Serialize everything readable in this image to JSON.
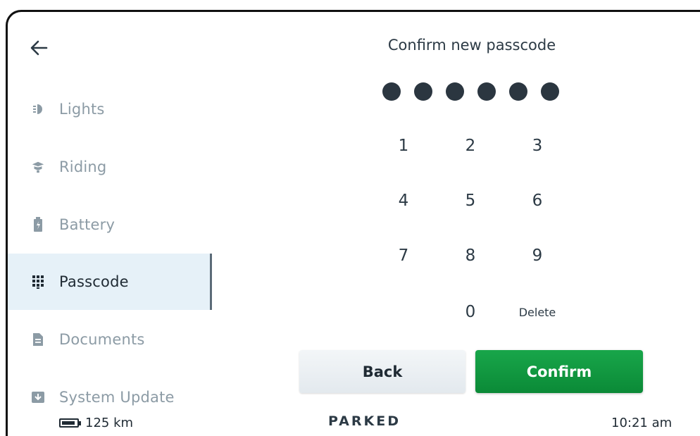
{
  "sidebar": {
    "items": [
      {
        "label": "Lights",
        "icon": "headlight-icon"
      },
      {
        "label": "Riding",
        "icon": "rider-icon"
      },
      {
        "label": "Battery",
        "icon": "battery-icon"
      },
      {
        "label": "Passcode",
        "icon": "keypad-icon",
        "active": true
      },
      {
        "label": "Documents",
        "icon": "document-icon"
      },
      {
        "label": "System Update",
        "icon": "download-icon"
      }
    ]
  },
  "passcode": {
    "title": "Confirm new passcode",
    "entered_digits": 6,
    "keys": [
      "1",
      "2",
      "3",
      "4",
      "5",
      "6",
      "7",
      "8",
      "9",
      "0"
    ],
    "delete_label": "Delete"
  },
  "actions": {
    "back_label": "Back",
    "confirm_label": "Confirm",
    "confirm_color": "#0e9a3f"
  },
  "statusbar": {
    "range": "125 km",
    "state": "PARKED",
    "time": "10:21 am"
  }
}
